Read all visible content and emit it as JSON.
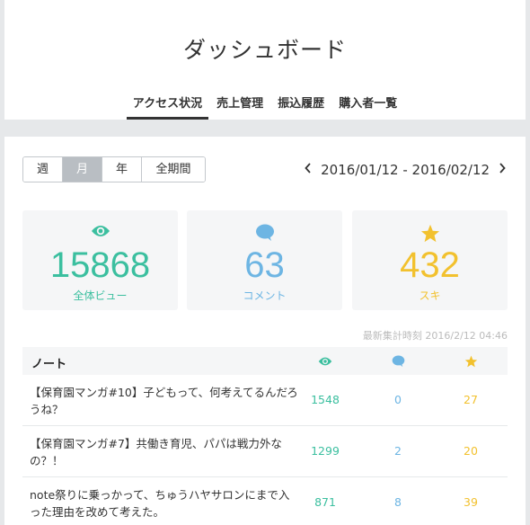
{
  "header": {
    "title": "ダッシュボード",
    "tabs": [
      {
        "label": "アクセス状況",
        "active": true
      },
      {
        "label": "売上管理",
        "active": false
      },
      {
        "label": "振込履歴",
        "active": false
      },
      {
        "label": "購入者一覧",
        "active": false
      }
    ]
  },
  "period": {
    "options": [
      {
        "label": "週",
        "active": false
      },
      {
        "label": "月",
        "active": true
      },
      {
        "label": "年",
        "active": false
      },
      {
        "label": "全期間",
        "active": false
      }
    ],
    "range": "2016/01/12 - 2016/02/12",
    "prev_icon": "chevron-left-icon",
    "next_icon": "chevron-right-icon"
  },
  "stats": {
    "views": {
      "value": "15868",
      "label": "全体ビュー",
      "icon": "eye-icon",
      "color": "#3bbf9f"
    },
    "comments": {
      "value": "63",
      "label": "コメント",
      "icon": "speech-bubble-icon",
      "color": "#6db5e3"
    },
    "likes": {
      "value": "432",
      "label": "スキ",
      "icon": "star-icon",
      "color": "#f2c12e"
    }
  },
  "updated": "最新集計時刻 2016/2/12 04:46",
  "table": {
    "header_note": "ノート",
    "rows": [
      {
        "title": "【保育園マンガ#10】子どもって、何考えてるんだろうね？",
        "views": "1548",
        "comments": "0",
        "likes": "27"
      },
      {
        "title": "【保育園マンガ#7】共働き育児、パパは戦力外なの？！",
        "views": "1299",
        "comments": "2",
        "likes": "20"
      },
      {
        "title": "note祭りに乗っかって、ちゅうハヤサロンにまで入った理由を改めて考えた。",
        "views": "871",
        "comments": "8",
        "likes": "39"
      }
    ]
  }
}
